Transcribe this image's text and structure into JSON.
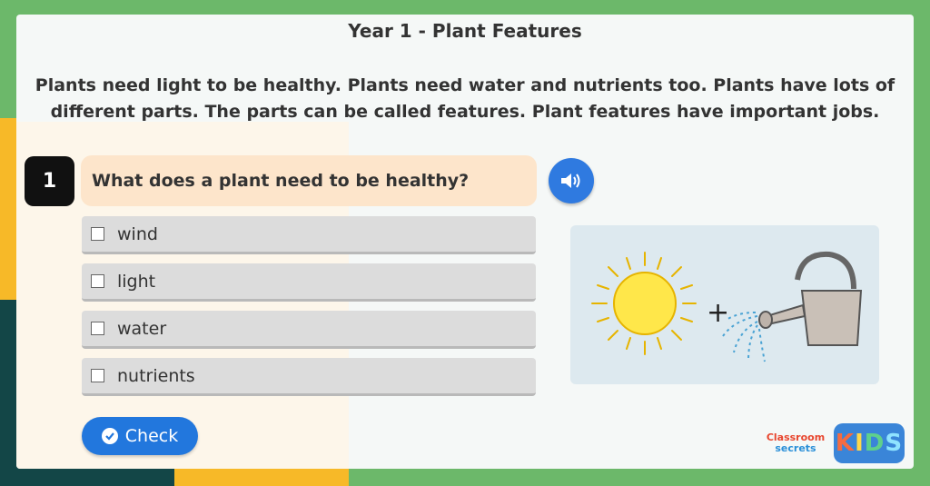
{
  "header": {
    "title": "Year 1 - Plant Features",
    "intro": "Plants need light to be healthy. Plants need water and nutrients too. Plants have lots of different parts. The parts can be called features. Plant features have important jobs."
  },
  "question": {
    "number": "1",
    "text": "What does a plant need to be healthy?"
  },
  "options": [
    {
      "label": "wind"
    },
    {
      "label": "light"
    },
    {
      "label": "water"
    },
    {
      "label": "nutrients"
    }
  ],
  "actions": {
    "check_label": "Check"
  },
  "illustration": {
    "plus": "+"
  },
  "branding": {
    "classroom": "Classroom",
    "secrets": "secrets",
    "kids": [
      "K",
      "I",
      "D",
      "S"
    ]
  },
  "colors": {
    "background": "#6cb86a",
    "accent_blue": "#2277dd",
    "question_bg": "#fde5cb",
    "option_bg": "#dcdcdc"
  }
}
